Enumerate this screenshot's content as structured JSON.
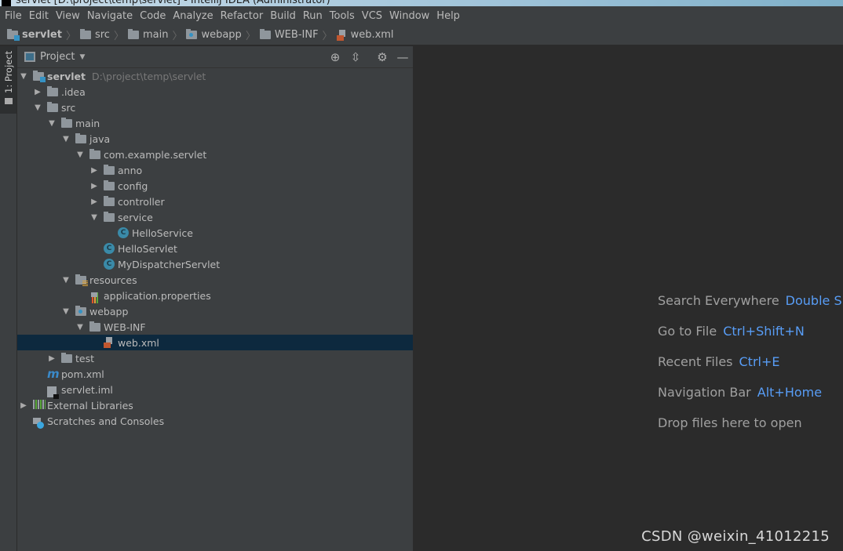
{
  "window": {
    "title": "servlet [D:\\project\\temp\\servlet] - IntelliJ IDEA (Administrator)"
  },
  "menu": [
    "File",
    "Edit",
    "View",
    "Navigate",
    "Code",
    "Analyze",
    "Refactor",
    "Build",
    "Run",
    "Tools",
    "VCS",
    "Window",
    "Help"
  ],
  "breadcrumb": [
    "servlet",
    "src",
    "main",
    "webapp",
    "WEB-INF",
    "web.xml"
  ],
  "sidestrip": {
    "tab_label": "1: Project"
  },
  "panel": {
    "title": "Project",
    "tools": [
      "locate-icon",
      "collapse-all-icon",
      "gear-icon",
      "minimize-icon"
    ]
  },
  "tree": [
    {
      "label": "servlet",
      "hint": "D:\\project\\temp\\servlet",
      "level": 0,
      "arrow": "open",
      "icon": "module-folder",
      "bold": true
    },
    {
      "label": ".idea",
      "level": 1,
      "arrow": "closed",
      "icon": "folder"
    },
    {
      "label": "src",
      "level": 1,
      "arrow": "open",
      "icon": "folder"
    },
    {
      "label": "main",
      "level": 2,
      "arrow": "open",
      "icon": "folder"
    },
    {
      "label": "java",
      "level": 3,
      "arrow": "open",
      "icon": "source-folder"
    },
    {
      "label": "com.example.servlet",
      "level": 4,
      "arrow": "open",
      "icon": "package"
    },
    {
      "label": "anno",
      "level": 5,
      "arrow": "closed",
      "icon": "package"
    },
    {
      "label": "config",
      "level": 5,
      "arrow": "closed",
      "icon": "package"
    },
    {
      "label": "controller",
      "level": 5,
      "arrow": "closed",
      "icon": "package"
    },
    {
      "label": "service",
      "level": 5,
      "arrow": "open",
      "icon": "package"
    },
    {
      "label": "HelloService",
      "level": 6,
      "arrow": "none",
      "icon": "class"
    },
    {
      "label": "HelloServlet",
      "level": 5,
      "arrow": "none",
      "icon": "class"
    },
    {
      "label": "MyDispatcherServlet",
      "level": 5,
      "arrow": "none",
      "icon": "class"
    },
    {
      "label": "resources",
      "level": 3,
      "arrow": "open",
      "icon": "resources-folder"
    },
    {
      "label": "application.properties",
      "level": 4,
      "arrow": "none",
      "icon": "properties"
    },
    {
      "label": "webapp",
      "level": 3,
      "arrow": "open",
      "icon": "web-folder"
    },
    {
      "label": "WEB-INF",
      "level": 4,
      "arrow": "open",
      "icon": "folder"
    },
    {
      "label": "web.xml",
      "level": 5,
      "arrow": "none",
      "icon": "xml",
      "selected": true
    },
    {
      "label": "test",
      "level": 2,
      "arrow": "closed",
      "icon": "folder"
    },
    {
      "label": "pom.xml",
      "level": 1,
      "arrow": "none",
      "icon": "maven"
    },
    {
      "label": "servlet.iml",
      "level": 1,
      "arrow": "none",
      "icon": "iml"
    },
    {
      "label": "External Libraries",
      "level": 0,
      "arrow": "closed",
      "icon": "libraries"
    },
    {
      "label": "Scratches and Consoles",
      "level": 0,
      "arrow": "none",
      "icon": "scratches"
    }
  ],
  "editor_hints": [
    {
      "label": "Search Everywhere",
      "shortcut": "Double Shift"
    },
    {
      "label": "Go to File",
      "shortcut": "Ctrl+Shift+N"
    },
    {
      "label": "Recent Files",
      "shortcut": "Ctrl+E"
    },
    {
      "label": "Navigation Bar",
      "shortcut": "Alt+Home"
    },
    {
      "label": "Drop files here to open",
      "shortcut": ""
    }
  ],
  "watermark": "CSDN @weixin_41012215",
  "colors": {
    "panel_bg": "#3c3f41",
    "editor_bg": "#2b2b2b",
    "selection": "#0d293e",
    "shortcut": "#589df6"
  }
}
